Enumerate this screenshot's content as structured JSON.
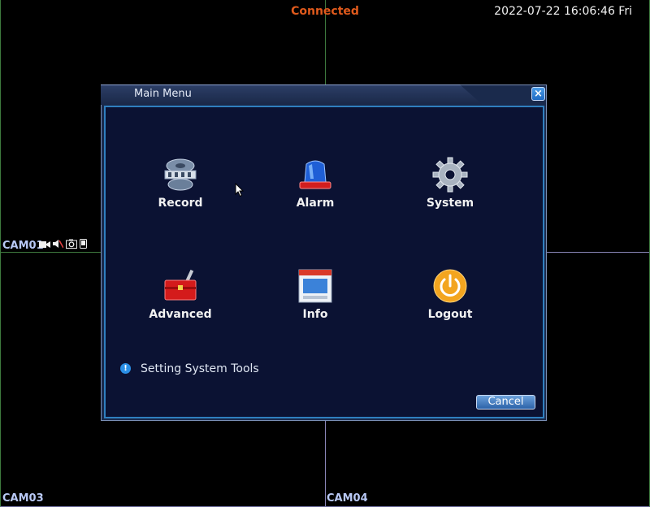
{
  "status": {
    "text": "Connected",
    "color": "#e05a1c"
  },
  "datetime": "2022-07-22 16:06:46 Fri",
  "cameras": {
    "cam01": {
      "label": "CAM01",
      "status_icons": [
        "camera-icon",
        "audio-muted-icon",
        "snapshot-icon",
        "phone-icon"
      ]
    },
    "cam03": {
      "label": "CAM03"
    },
    "cam04": {
      "label": "CAM04"
    }
  },
  "dialog": {
    "title": "Main Menu",
    "close_icon": "close-icon",
    "tiles": [
      {
        "label": "Record",
        "icon": "film-reel-icon"
      },
      {
        "label": "Alarm",
        "icon": "siren-icon"
      },
      {
        "label": "System",
        "icon": "gear-icon"
      },
      {
        "label": "Advanced",
        "icon": "toolbox-icon"
      },
      {
        "label": "Info",
        "icon": "window-info-icon"
      },
      {
        "label": "Logout",
        "icon": "power-icon"
      }
    ],
    "hint": "Setting System Tools",
    "cancel_label": "Cancel"
  }
}
